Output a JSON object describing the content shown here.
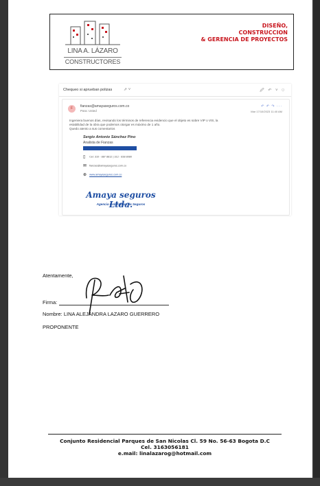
{
  "header": {
    "logo_name": "LINA A. LÁZARO",
    "logo_sub": "CONSTRUCTORES",
    "company_line1": "DISEÑO,",
    "company_line2": "CONSTRUCCION",
    "company_line3": "& GERENCIA DE PROYECTOS"
  },
  "email": {
    "subject": "Chequeo si aprueban polizas",
    "top_icons": "⇗ ˅",
    "top_right": "🖉 ↶ ˅ ⛉",
    "avatar_letter": "F",
    "from": "fianzas@amayaseguros.com.co",
    "to": "Para: Usted",
    "actions": "↶ ↶ ↷ ···",
    "date": "Mar 17/10/2023 11:40 AM",
    "body_line1": "Ingeniera buenos días, revisando los términos de referencia evidencio que el objeto es sobre VIP o VIS, la",
    "body_line2": "estabilidad de la obra que podemos otorgar es máximo de 1 año.",
    "body_line3": "Quedo atento a sus comentarios",
    "sig_name": "Sergio Antonio Sánchez Pino",
    "sig_role": "Analista de Fianzas",
    "phone": "Cel: 310 - 887 8812 | 312 - 838 8080",
    "mail": "fianzas@amayaseguros.com.co",
    "web": "www.amayaseguros.com.co",
    "company": "Amaya seguros Ltda.",
    "company_sub": "Agencia Colocadora de Seguros"
  },
  "closing": {
    "greeting": "Atentamente,",
    "firma_label": "Firma:",
    "nombre": "Nombre: LINA ALEJANDRA LAZARO GUERRERO",
    "role": "PROPONENTE"
  },
  "footer": {
    "address": "Conjunto Residencial Parques de San Nicolas Cl. 59 No. 56-63 Bogota D.C",
    "phone": "Cel. 3163056181",
    "email": "e.mail: linalazarog@hotmail.com"
  }
}
